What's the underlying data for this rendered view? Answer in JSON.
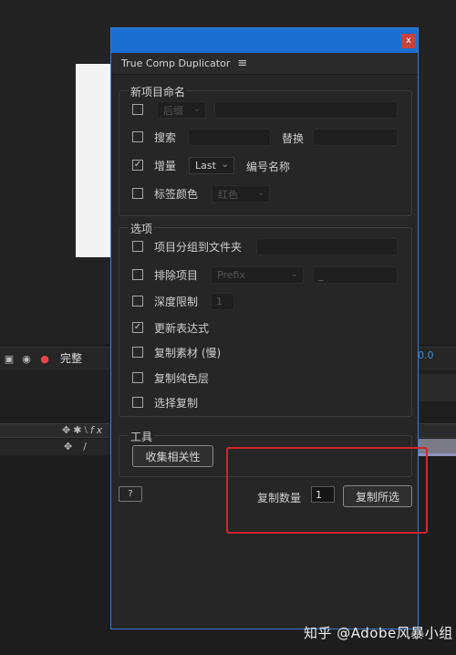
{
  "background": {
    "quality_label": "完整",
    "right_value": "0.0"
  },
  "window": {
    "close_glyph": "x",
    "panel_title": "True Comp Duplicator",
    "menu_glyph": "≡"
  },
  "naming_group": {
    "title": "新项目命名",
    "rows": {
      "prefix": {
        "checked": false,
        "dropdown": "后缀",
        "field": ""
      },
      "search": {
        "checked": false,
        "label": "搜索",
        "replace_label": "替换"
      },
      "increment": {
        "checked": true,
        "label": "增量",
        "dropdown": "Last",
        "suffix_label": "编号名称"
      },
      "label_color": {
        "checked": false,
        "label": "标签颜色",
        "dropdown": "红色"
      }
    }
  },
  "options_group": {
    "title": "选项",
    "rows": {
      "group_folder": {
        "checked": false,
        "label": "项目分组到文件夹"
      },
      "exclude": {
        "checked": false,
        "label": "排除项目",
        "dropdown": "Prefix",
        "field": "_"
      },
      "depth_limit": {
        "checked": false,
        "label": "深度限制",
        "value": "1"
      },
      "update_expr": {
        "checked": true,
        "label": "更新表达式"
      },
      "dup_footage": {
        "checked": false,
        "label": "复制素材 (慢)"
      },
      "dup_solids": {
        "checked": false,
        "label": "复制纯色层"
      },
      "select_dup": {
        "checked": false,
        "label": "选择复制"
      }
    }
  },
  "tools_group": {
    "title": "工具",
    "collect_button": "收集相关性"
  },
  "footer": {
    "help_button": "?",
    "count_label": "复制数量",
    "count_value": "1",
    "duplicate_button": "复制所选"
  },
  "watermark": "知乎 @Adobe风暴小组",
  "colors": {
    "titlebar": "#1a6fd1",
    "highlight": "#d8232a",
    "close_button": "#c9423c"
  }
}
